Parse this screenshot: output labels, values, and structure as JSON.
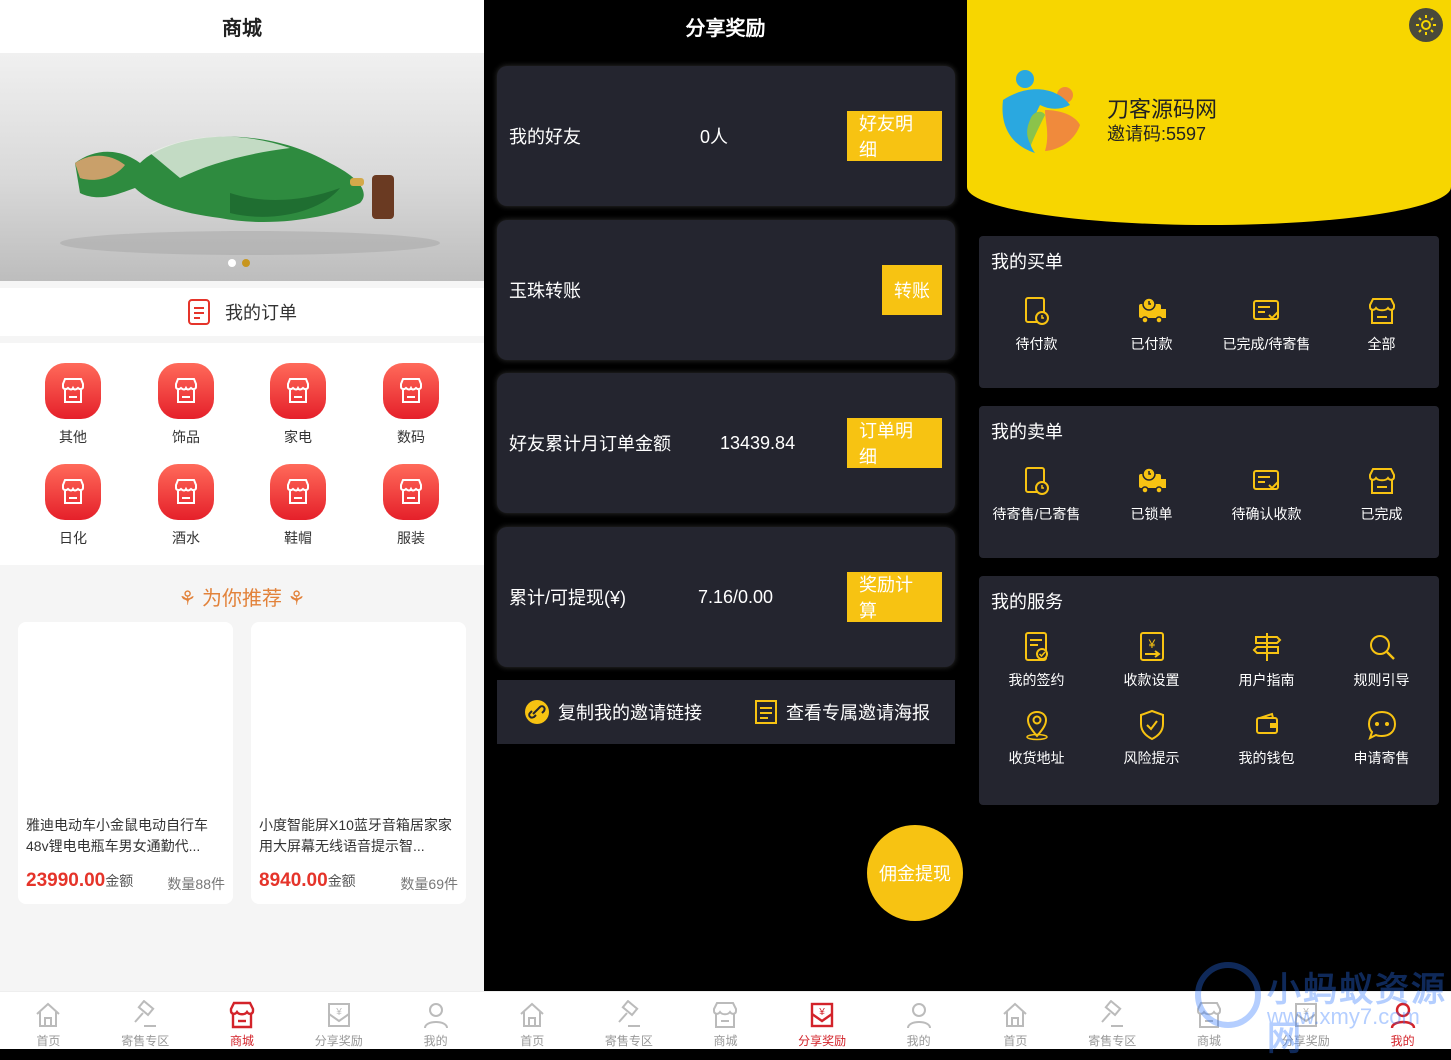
{
  "shop": {
    "title": "商城",
    "my_orders": "我的订单",
    "categories": [
      "其他",
      "饰品",
      "家电",
      "数码",
      "日化",
      "酒水",
      "鞋帽",
      "服装"
    ],
    "recommend": "为你推荐",
    "products": [
      {
        "title": "雅迪电动车小金鼠电动自行车48v锂电电瓶车男女通勤代...",
        "price": "23990.00",
        "unit": "金额",
        "qty": "数量88件"
      },
      {
        "title": "小度智能屏X10蓝牙音箱居家家用大屏幕无线语音提示智...",
        "price": "8940.00",
        "unit": "金额",
        "qty": "数量69件"
      }
    ]
  },
  "share": {
    "title": "分享奖励",
    "rows": [
      {
        "label": "我的好友",
        "value": "0人",
        "button": "好友明细"
      },
      {
        "label": "玉珠转账",
        "value": "",
        "button": "转账"
      },
      {
        "label": "好友累计月订单金额",
        "value": "13439.84",
        "button": "订单明细"
      },
      {
        "label": "累计/可提现(¥)",
        "value": "7.16/0.00",
        "button": "奖励计算"
      }
    ],
    "copy_link": "复制我的邀请链接",
    "poster": "查看专属邀请海报",
    "fab": "佣金提现"
  },
  "mine": {
    "user_name": "刀客源码网",
    "invite_code": "邀请码:5597",
    "buy": {
      "title": "我的买单",
      "items": [
        "待付款",
        "已付款",
        "已完成/待寄售",
        "全部"
      ]
    },
    "sell": {
      "title": "我的卖单",
      "items": [
        "待寄售/已寄售",
        "已锁单",
        "待确认收款",
        "已完成"
      ]
    },
    "service": {
      "title": "我的服务",
      "items": [
        "我的签约",
        "收款设置",
        "用户指南",
        "规则引导",
        "收货地址",
        "风险提示",
        "我的钱包",
        "申请寄售"
      ]
    }
  },
  "tabbar": {
    "labels": [
      "首页",
      "寄售专区",
      "商城",
      "分享奖励",
      "我的"
    ]
  },
  "watermark": {
    "line1": "小蚂蚁资源网",
    "line2": "www.xmy7.com"
  },
  "colors": {
    "accent_yellow": "#f7c312",
    "accent_red": "#d3232a",
    "panel_dark": "#24252f",
    "price_red": "#e5342a"
  }
}
